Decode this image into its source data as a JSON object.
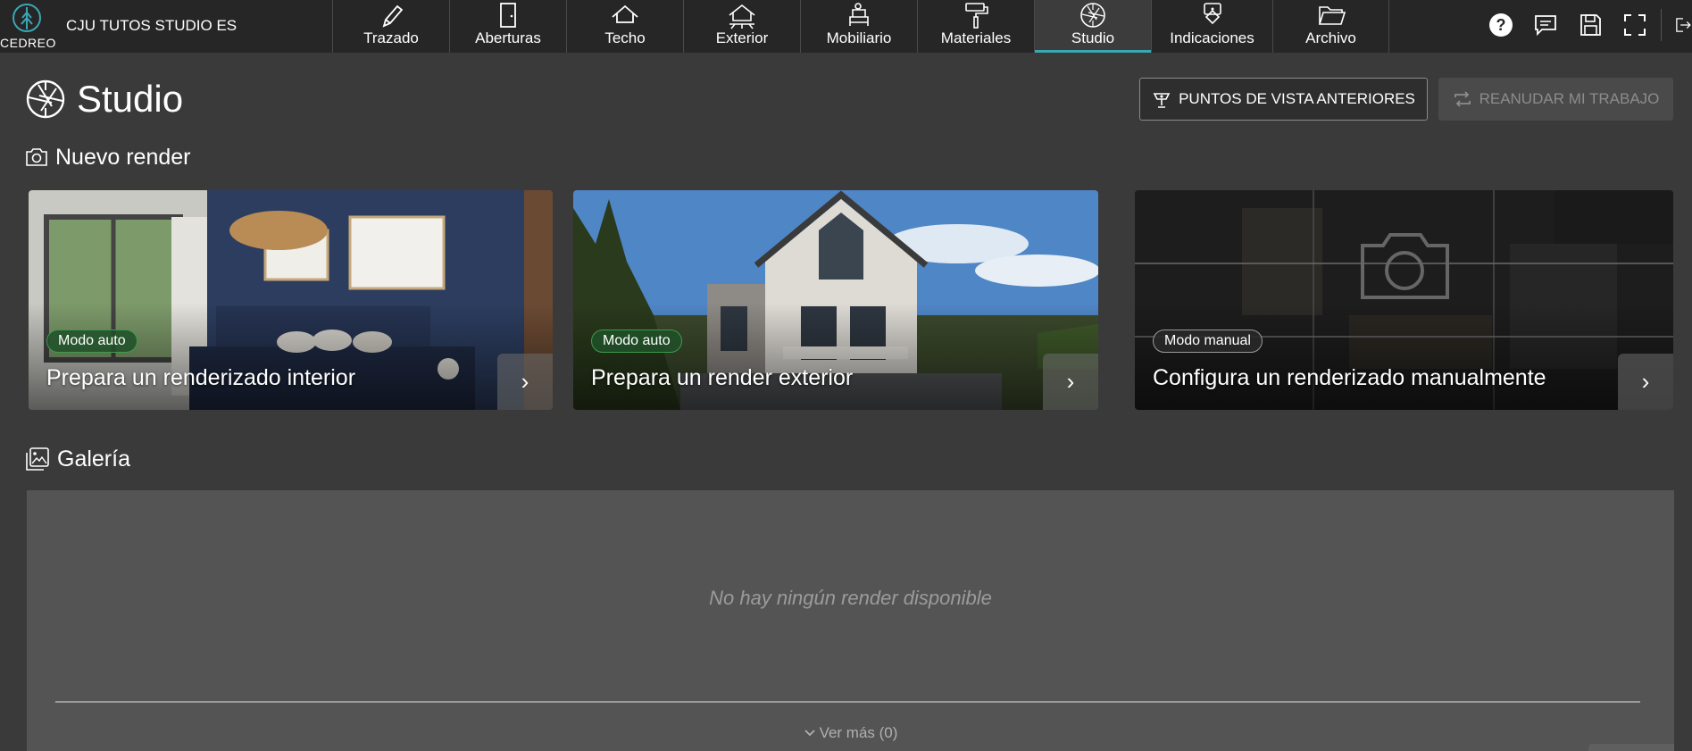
{
  "app": {
    "logo_text": "CEDREO",
    "project_name": "CJU TUTOS STUDIO ES"
  },
  "nav": {
    "tabs": [
      {
        "label": "Trazado",
        "icon": "pencil-icon"
      },
      {
        "label": "Aberturas",
        "icon": "door-icon"
      },
      {
        "label": "Techo",
        "icon": "roof-icon"
      },
      {
        "label": "Exterior",
        "icon": "house-exterior-icon"
      },
      {
        "label": "Mobiliario",
        "icon": "furniture-icon"
      },
      {
        "label": "Materiales",
        "icon": "paint-roller-icon"
      },
      {
        "label": "Studio",
        "icon": "aperture-icon",
        "active": true
      },
      {
        "label": "Indicaciones",
        "icon": "annotation-icon"
      },
      {
        "label": "Archivo",
        "icon": "folder-icon"
      }
    ]
  },
  "top_actions": [
    "help-icon",
    "chat-icon",
    "save-icon",
    "fullscreen-icon",
    "exit-icon"
  ],
  "header": {
    "title": "Studio",
    "btn_previous": "PUNTOS DE VISTA ANTERIORES",
    "btn_resume": "REANUDAR MI TRABAJO"
  },
  "new_render": {
    "title": "Nuevo render",
    "cards": [
      {
        "mode": "Modo auto",
        "title": "Prepara un renderizado interior"
      },
      {
        "mode": "Modo auto",
        "title": "Prepara un render exterior"
      },
      {
        "mode": "Modo manual",
        "title": "Configura un renderizado manualmente"
      }
    ]
  },
  "gallery": {
    "title": "Galería",
    "empty_text": "No hay ningún render disponible",
    "see_more": "Ver más (0)"
  },
  "colors": {
    "accent": "#3aa7b4",
    "background": "#3a3a3a",
    "topbar": "#262626",
    "auto_pill_border": "#3e9a4f"
  }
}
